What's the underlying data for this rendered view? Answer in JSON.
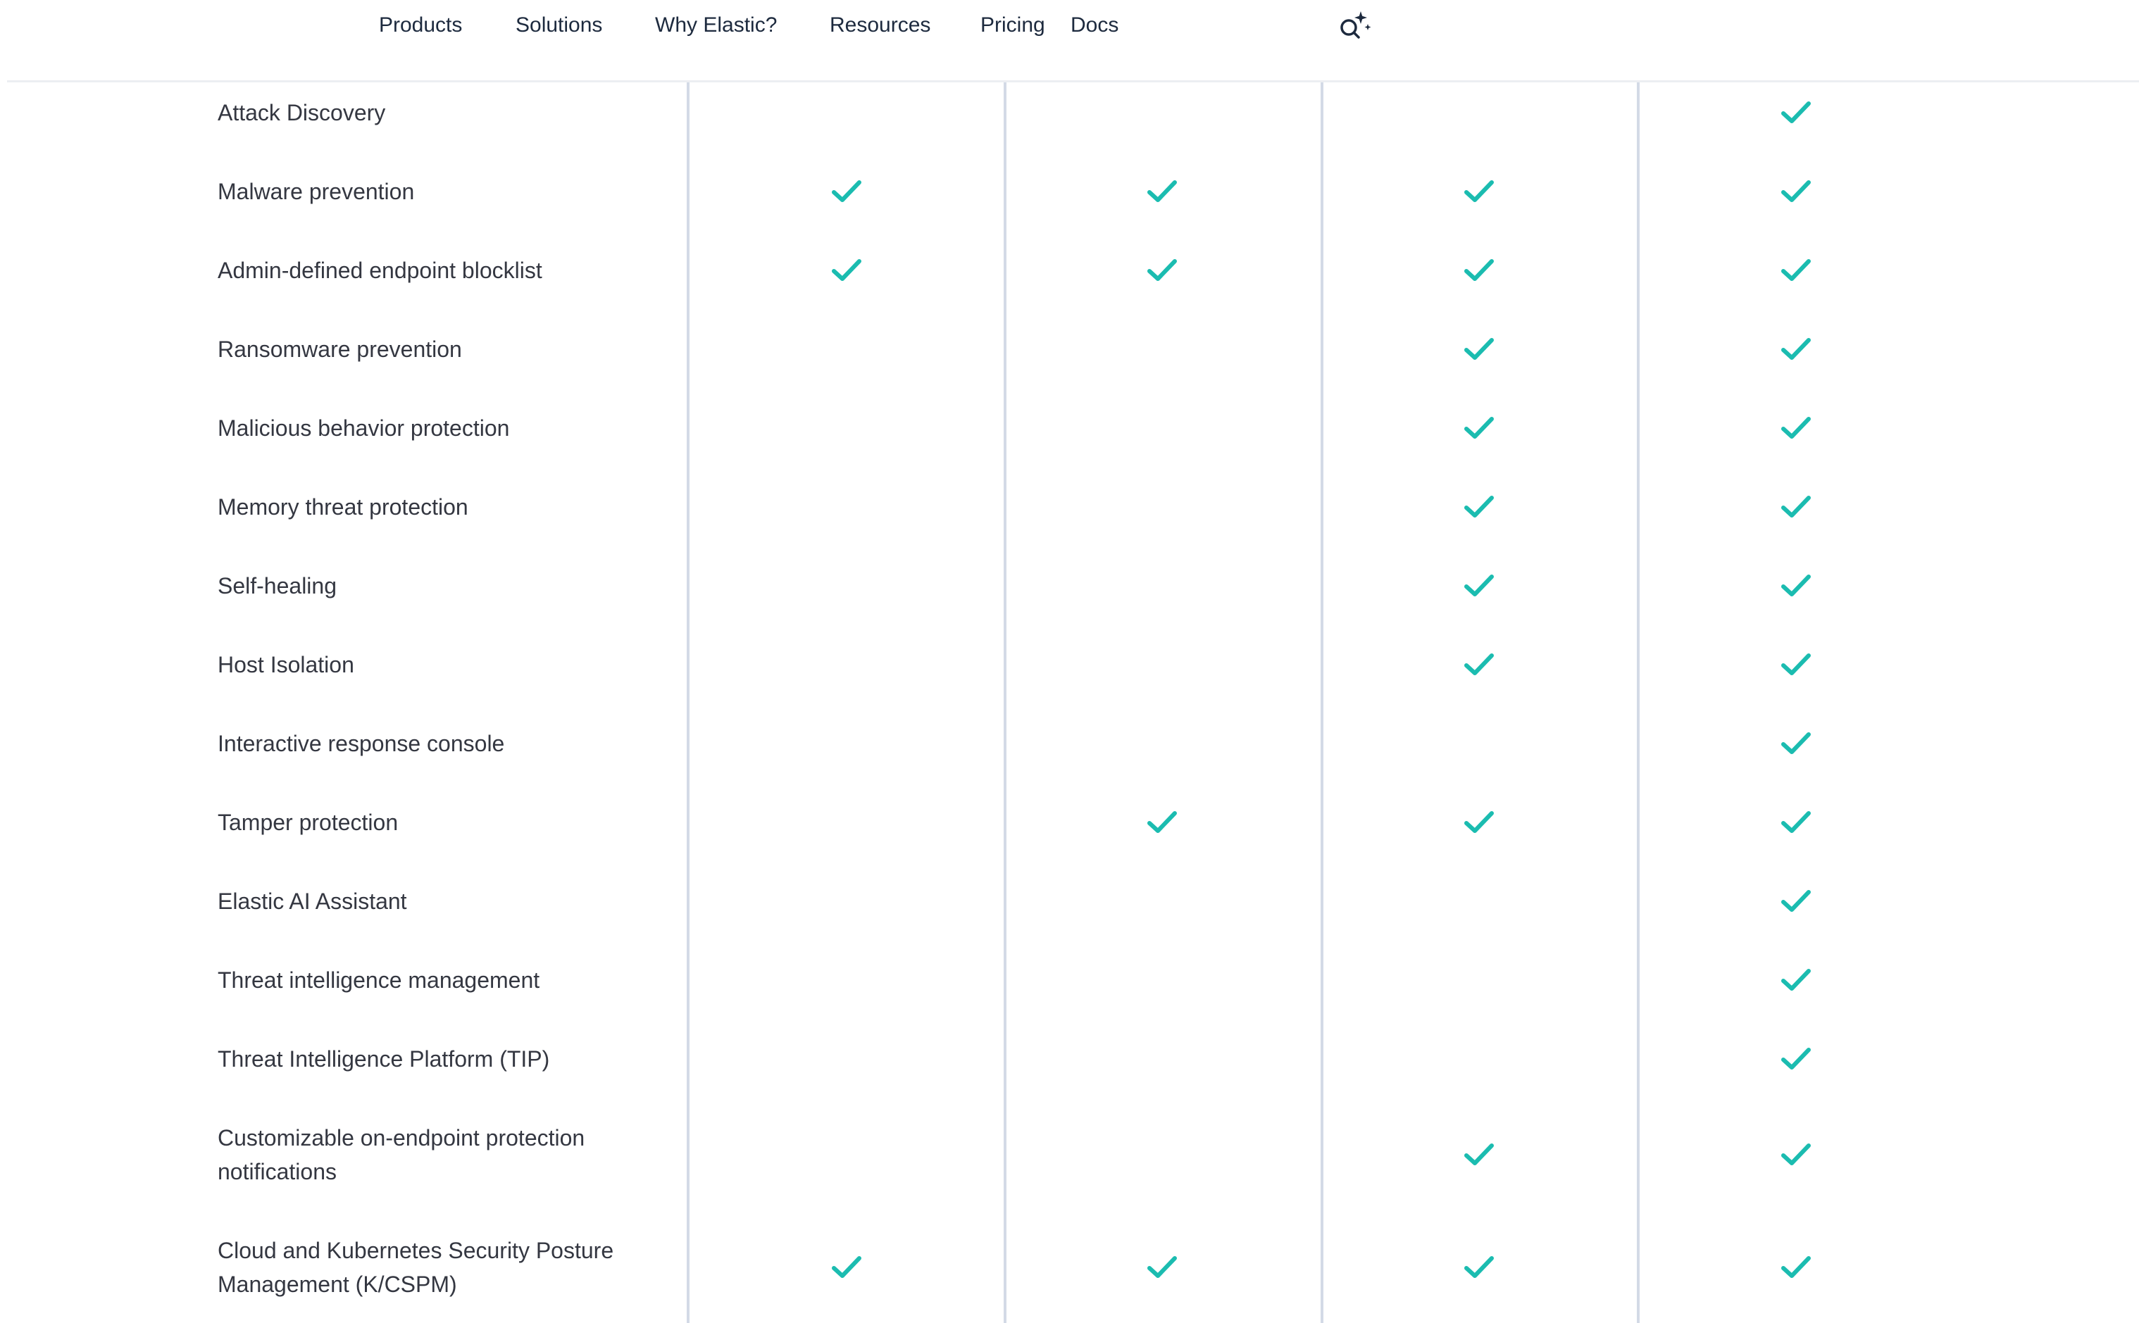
{
  "nav": {
    "items": [
      {
        "label": "Products"
      },
      {
        "label": "Solutions"
      },
      {
        "label": "Why Elastic?"
      },
      {
        "label": "Resources"
      },
      {
        "label": "Pricing"
      },
      {
        "label": "Docs"
      }
    ],
    "search_icon": "search-sparkle-icon"
  },
  "colors": {
    "check": "#1bbcb0",
    "divider": "#d3dae6",
    "text": "#343741"
  },
  "comparison": {
    "rows": [
      {
        "feature": "Attack Discovery",
        "checks": [
          false,
          false,
          false,
          true
        ]
      },
      {
        "feature": "Malware prevention",
        "checks": [
          true,
          true,
          true,
          true
        ]
      },
      {
        "feature": "Admin-defined endpoint blocklist",
        "checks": [
          true,
          true,
          true,
          true
        ]
      },
      {
        "feature": "Ransomware prevention",
        "checks": [
          false,
          false,
          true,
          true
        ]
      },
      {
        "feature": "Malicious behavior protection",
        "checks": [
          false,
          false,
          true,
          true
        ]
      },
      {
        "feature": "Memory threat protection",
        "checks": [
          false,
          false,
          true,
          true
        ]
      },
      {
        "feature": "Self-healing",
        "checks": [
          false,
          false,
          true,
          true
        ]
      },
      {
        "feature": "Host Isolation",
        "checks": [
          false,
          false,
          true,
          true
        ]
      },
      {
        "feature": "Interactive response console",
        "checks": [
          false,
          false,
          false,
          true
        ]
      },
      {
        "feature": "Tamper protection",
        "checks": [
          false,
          true,
          true,
          true
        ]
      },
      {
        "feature": "Elastic AI Assistant",
        "checks": [
          false,
          false,
          false,
          true
        ]
      },
      {
        "feature": "Threat intelligence management",
        "checks": [
          false,
          false,
          false,
          true
        ]
      },
      {
        "feature": "Threat Intelligence Platform (TIP)",
        "checks": [
          false,
          false,
          false,
          true
        ]
      },
      {
        "feature": "Customizable on-endpoint protection notifications",
        "checks": [
          false,
          false,
          true,
          true
        ]
      },
      {
        "feature": "Cloud and Kubernetes Security Posture Management (K/CSPM)",
        "checks": [
          true,
          true,
          true,
          true
        ]
      }
    ]
  }
}
